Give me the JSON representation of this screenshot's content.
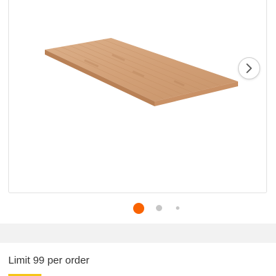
{
  "product_gallery": {
    "image_alt": "butcher block countertop",
    "next_icon": "chevron-right-icon",
    "slide_count": 3,
    "active_slide": 1
  },
  "colors": {
    "accent": "#f96302",
    "dot_inactive": "#c6c6c6",
    "wood_light": "#d5a57a",
    "wood_edge": "#b98156"
  },
  "purchase": {
    "limit_text": "Limit 99 per order"
  }
}
